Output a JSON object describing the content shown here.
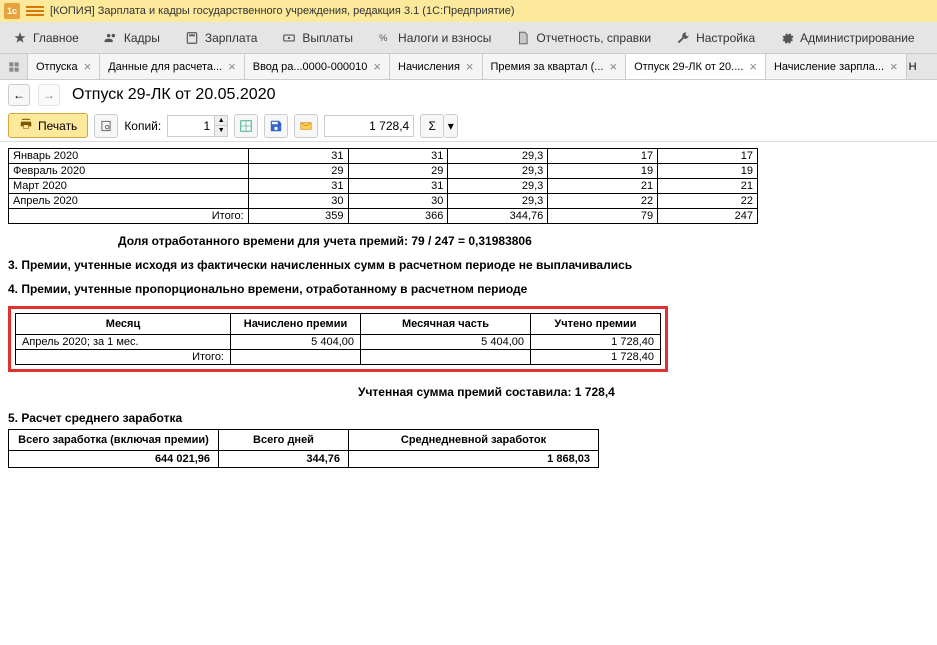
{
  "app": {
    "title": "[КОПИЯ] Зарплата и кадры государственного учреждения, редакция 3.1  (1С:Предприятие)"
  },
  "menu": {
    "main": "Главное",
    "staff": "Кадры",
    "salary": "Зарплата",
    "payments": "Выплаты",
    "taxes": "Налоги и взносы",
    "reports": "Отчетность, справки",
    "settings": "Настройка",
    "admin": "Администрирование"
  },
  "tabs": {
    "t1": "Отпуска",
    "t2": "Данные для расчета...",
    "t3": "Ввод ра...0000-000010",
    "t4": "Начисления",
    "t5": "Премия за квартал (...",
    "t6": "Отпуск 29-ЛК от 20....",
    "t7": "Начисление зарпла...",
    "edge": "Н"
  },
  "doc": {
    "title": "Отпуск 29-ЛК от 20.05.2020"
  },
  "toolbar": {
    "print": "Печать",
    "copies_label": "Копий:",
    "copies_value": "1",
    "sum_value": "1 728,4"
  },
  "months_table": {
    "rows": [
      {
        "m": "Январь 2020",
        "c1": "31",
        "c2": "31",
        "c3": "29,3",
        "c4": "17",
        "c5": "17"
      },
      {
        "m": "Февраль 2020",
        "c1": "29",
        "c2": "29",
        "c3": "29,3",
        "c4": "19",
        "c5": "19"
      },
      {
        "m": "Март 2020",
        "c1": "31",
        "c2": "31",
        "c3": "29,3",
        "c4": "21",
        "c5": "21"
      },
      {
        "m": "Апрель 2020",
        "c1": "30",
        "c2": "30",
        "c3": "29,3",
        "c4": "22",
        "c5": "22"
      }
    ],
    "total_label": "Итого:",
    "totals": {
      "c1": "359",
      "c2": "366",
      "c3": "344,76",
      "c4": "79",
      "c5": "247"
    }
  },
  "share_line": "Доля отработанного времени для учета премий:  79 / 247 = 0,31983806",
  "section3": "3. Премии, учтенные исходя из фактически начисленных сумм в расчетном периоде не выплачивались",
  "section4": "4. Премии, учтенные пропорционально времени, отработанному в расчетном периоде",
  "bonus_table": {
    "h1": "Месяц",
    "h2": "Начислено премии",
    "h3": "Месячная часть",
    "h4": "Учтено премии",
    "row_month": "Апрель 2020; за 1 мес.",
    "row_accrued": "5 404,00",
    "row_part": "5 404,00",
    "row_counted": "1 728,40",
    "itogo": "Итого:",
    "itogo_val": "1 728,40"
  },
  "summary": "Учтенная сумма премий составила: 1 728,4",
  "section5": "5. Расчет среднего  заработка",
  "avg_table": {
    "h1": "Всего заработка (включая премии)",
    "h2": "Всего дней",
    "h3": "Среднедневной заработок",
    "v1": "644 021,96",
    "v2": "344,76",
    "v3": "1 868,03"
  }
}
